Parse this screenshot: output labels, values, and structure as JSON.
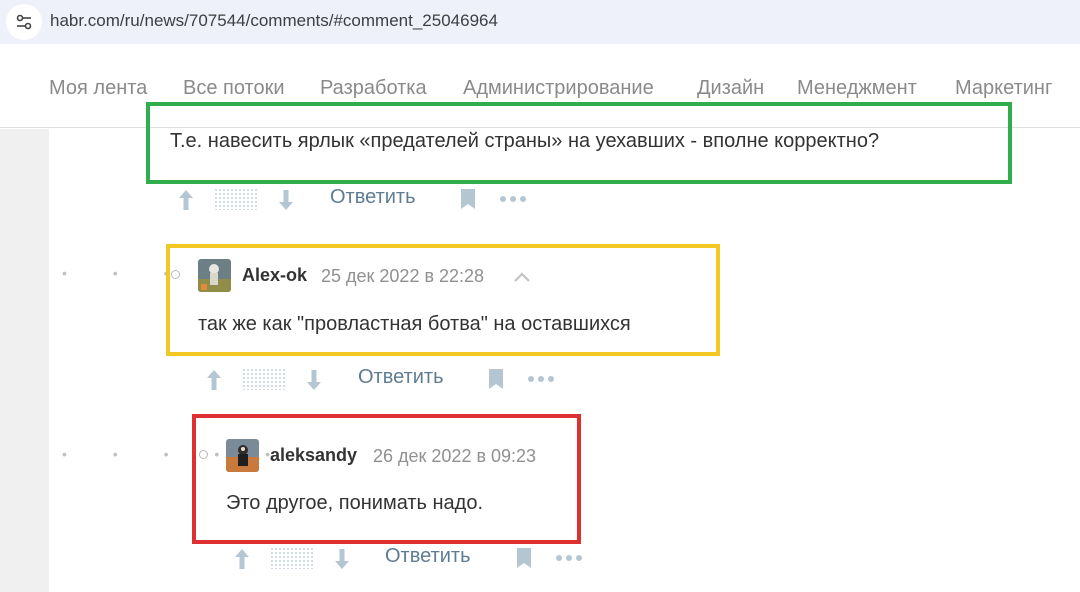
{
  "browser": {
    "url": "habr.com/ru/news/707544/comments/#comment_25046964",
    "site_icon": "tune-icon"
  },
  "nav": {
    "items": [
      {
        "label": "Моя лента"
      },
      {
        "label": "Все потоки"
      },
      {
        "label": "Разработка"
      },
      {
        "label": "Администрирование"
      },
      {
        "label": "Дизайн"
      },
      {
        "label": "Менеджмент"
      },
      {
        "label": "Маркетинг"
      }
    ]
  },
  "comments": [
    {
      "text": "Т.е. навесить ярлык «предателей страны» на уехавших - вполне корректно?",
      "actions": {
        "reply": "Ответить"
      }
    },
    {
      "author": "Alex-ok",
      "time": "25 дек 2022 в 22:28",
      "text": "так же как \"провластная ботва\" на оставшихся",
      "actions": {
        "reply": "Ответить"
      }
    },
    {
      "author": "aleksandy",
      "time": "26 дек 2022 в 09:23",
      "text": "Это другое, понимать надо.",
      "actions": {
        "reply": "Ответить"
      }
    }
  ],
  "highlight_colors": {
    "green": "#2fae4b",
    "yellow": "#f3c824",
    "red": "#de2f31"
  },
  "icons": [
    "tune-icon",
    "arrow-up-icon",
    "arrow-down-icon",
    "bookmark-icon",
    "more-icon",
    "chevron-up-icon",
    "thread-dots",
    "avatar"
  ]
}
